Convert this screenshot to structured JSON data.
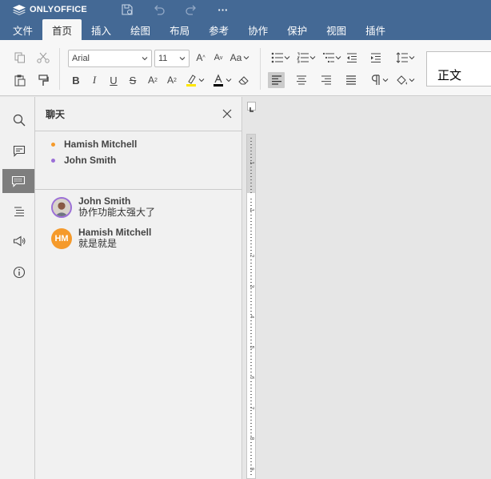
{
  "app": {
    "logo_text": "ONLYOFFICE",
    "title_icons": [
      "save-icon",
      "undo-icon",
      "redo-icon",
      "more-icon"
    ],
    "more_label": "···"
  },
  "tabs": [
    {
      "label": "文件"
    },
    {
      "label": "首页",
      "active": true
    },
    {
      "label": "插入"
    },
    {
      "label": "绘图"
    },
    {
      "label": "布局"
    },
    {
      "label": "参考"
    },
    {
      "label": "协作"
    },
    {
      "label": "保护"
    },
    {
      "label": "视图"
    },
    {
      "label": "插件"
    }
  ],
  "toolbar": {
    "font_name": "Arial",
    "font_size": "11",
    "style_preview": "正文",
    "text_buttons": {
      "bold": "B",
      "italic": "I",
      "underline": "U",
      "strike": "S",
      "superscript": "A",
      "subscript": "A",
      "grow": "A",
      "shrink": "A",
      "change_case": "Aa"
    }
  },
  "chat": {
    "title": "聊天",
    "users": [
      {
        "name": "Hamish Mitchell",
        "color": "#f59a2b"
      },
      {
        "name": "John Smith",
        "color": "#9b6fd7"
      }
    ],
    "messages": [
      {
        "author": "John Smith",
        "text": "协作功能太强大了",
        "avatar": "photo"
      },
      {
        "author": "Hamish Mitchell",
        "text": "就是就是",
        "avatar_initials": "HM",
        "avatar_color": "#f59a2b"
      }
    ]
  },
  "ruler": {
    "numbers": [
      "1",
      "1",
      "2",
      "3",
      "4",
      "5",
      "6",
      "7",
      "8",
      "9"
    ]
  },
  "colors": {
    "header": "#446995",
    "highlight": "#ffe600",
    "font_color": "#000000"
  }
}
